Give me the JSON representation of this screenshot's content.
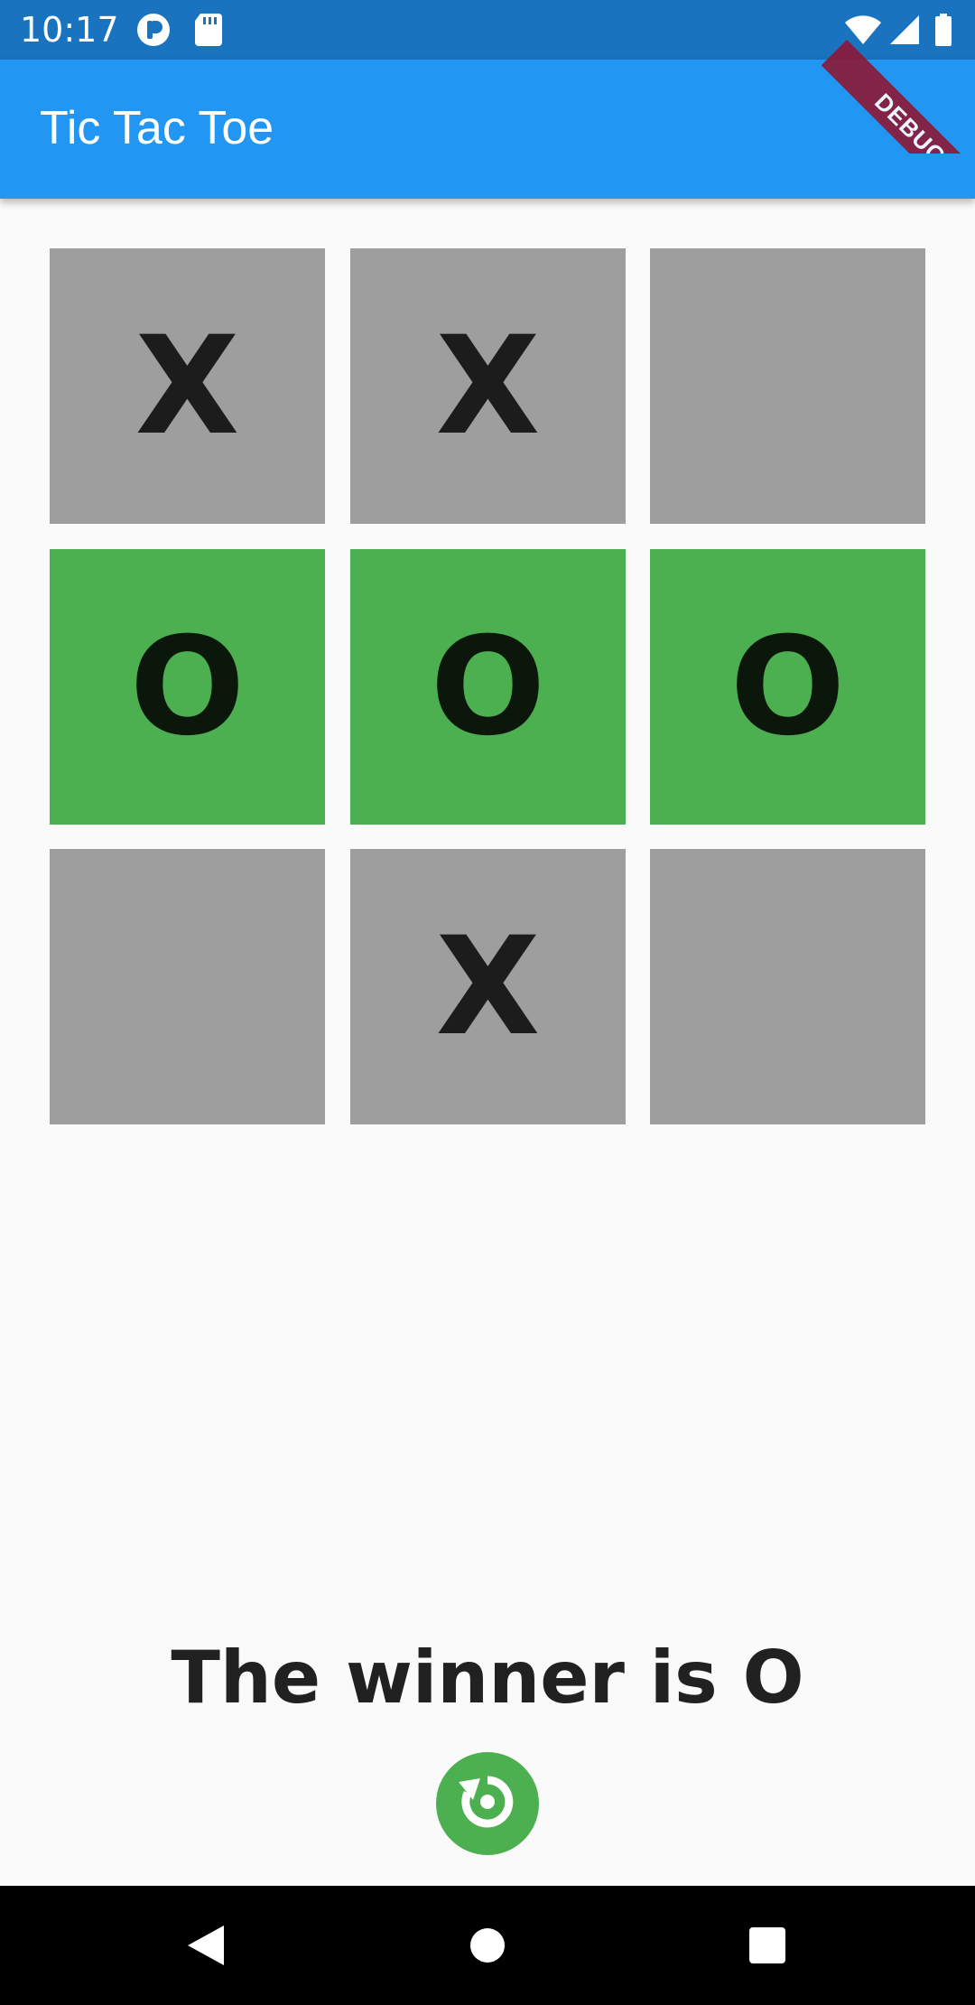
{
  "status_bar": {
    "time": "10:17",
    "icons": [
      "p-badge-icon",
      "sd-card-icon",
      "wifi-icon",
      "cell-signal-icon",
      "battery-icon"
    ]
  },
  "app_bar": {
    "title": "Tic Tac Toe"
  },
  "debug_banner": {
    "label": "DEBUG"
  },
  "board": {
    "cells": [
      {
        "mark": "X",
        "winning": false
      },
      {
        "mark": "X",
        "winning": false
      },
      {
        "mark": "",
        "winning": false
      },
      {
        "mark": "O",
        "winning": true
      },
      {
        "mark": "O",
        "winning": true
      },
      {
        "mark": "O",
        "winning": true
      },
      {
        "mark": "",
        "winning": false
      },
      {
        "mark": "X",
        "winning": false
      },
      {
        "mark": "",
        "winning": false
      }
    ]
  },
  "result": {
    "text": "The winner is O"
  },
  "restart": {
    "icon": "restart-icon"
  },
  "colors": {
    "status_bar": "#1a73bf",
    "app_bar": "#2196f3",
    "cell_default": "#9e9e9e",
    "cell_winning": "#4caf50",
    "restart_button": "#4caf50",
    "background": "#fafafa"
  },
  "nav_bar": {
    "buttons": [
      "back-icon",
      "home-icon",
      "recents-icon"
    ]
  }
}
